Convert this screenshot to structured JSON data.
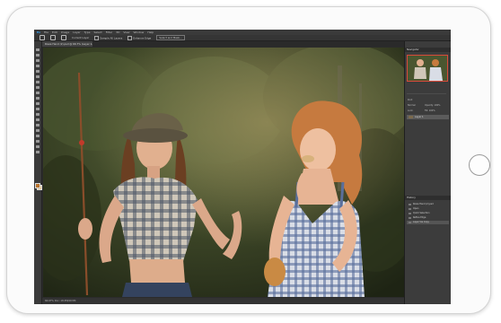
{
  "app": {
    "menu": [
      "Ps",
      "File",
      "Edit",
      "Image",
      "Layer",
      "Type",
      "Select",
      "Filter",
      "3D",
      "View",
      "Window",
      "Help"
    ],
    "options_bar": {
      "items": [
        "Current Layer",
        "Sample All Layers",
        "Enhance Edge",
        "Select and Mask..."
      ]
    },
    "document_tab": "Rosie Hand (2).psd @ 66.7% (Layer 1, RGB/8*) ×",
    "status_bar": "66.67%    Doc: 18.3M/40.5M"
  },
  "panels": {
    "navigator": {
      "title": "Navigator"
    },
    "layers": {
      "title": "Layers",
      "rows": [
        {
          "name": "Layer 1",
          "selected": true
        }
      ],
      "labels": [
        "Kind",
        "Normal",
        "Opacity: 100%",
        "Lock:",
        "Fill: 100%"
      ]
    },
    "history": {
      "title": "History",
      "rows": [
        "Rosie Hand (2).psd",
        "Open",
        "Quick Selection",
        "Refine Edge",
        "Layer Via Copy"
      ]
    }
  },
  "colors": {
    "foreground": "#b9732c",
    "background": "#e0c28a",
    "accent": "#d94a3a"
  },
  "icons": [
    "move-icon",
    "marquee-icon",
    "lasso-icon",
    "quick-select-icon",
    "crop-icon",
    "eyedropper-icon",
    "healing-brush-icon",
    "brush-icon",
    "clone-stamp-icon",
    "history-brush-icon",
    "eraser-icon",
    "gradient-icon",
    "blur-icon",
    "dodge-icon",
    "pen-icon",
    "type-icon",
    "path-select-icon",
    "shape-icon",
    "hand-icon",
    "zoom-icon"
  ]
}
